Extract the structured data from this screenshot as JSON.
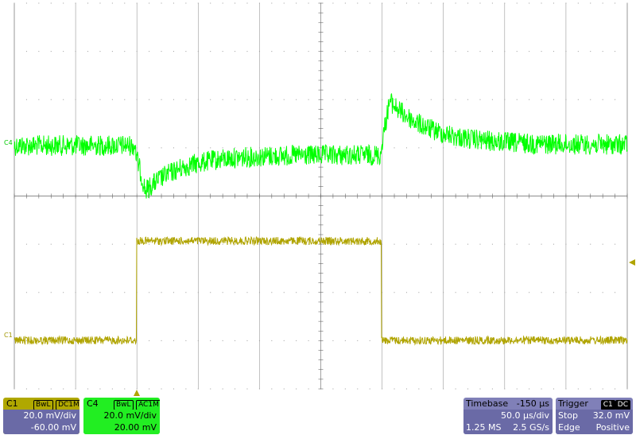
{
  "scope": {
    "colors": {
      "c4_trace": "#00ff00",
      "c1_trace": "#b0a400",
      "grid": "#9a9a9a",
      "background": "#ffffff"
    },
    "c4_marker": "C4",
    "c1_marker": "C1"
  },
  "c1_panel": {
    "name": "C1",
    "tag1": "BwL",
    "tag2": "DC1M",
    "scale": "20.0 mV/div",
    "offset": "-60.00 mV"
  },
  "c4_panel": {
    "name": "C4",
    "tag1": "BwL",
    "tag2": "AC1M",
    "scale": "20.0 mV/div",
    "offset": "20.00 mV"
  },
  "timebase_panel": {
    "label": "Timebase",
    "delay": "-150 µs",
    "scale": "50.0 µs/div",
    "samples": "1.25 MS",
    "rate": "2.5 GS/s"
  },
  "trigger_panel": {
    "label": "Trigger",
    "tag1": "C1",
    "tag2": "DC",
    "mode": "Stop",
    "level": "32.0 mV",
    "type": "Edge",
    "slope": "Positive"
  }
}
